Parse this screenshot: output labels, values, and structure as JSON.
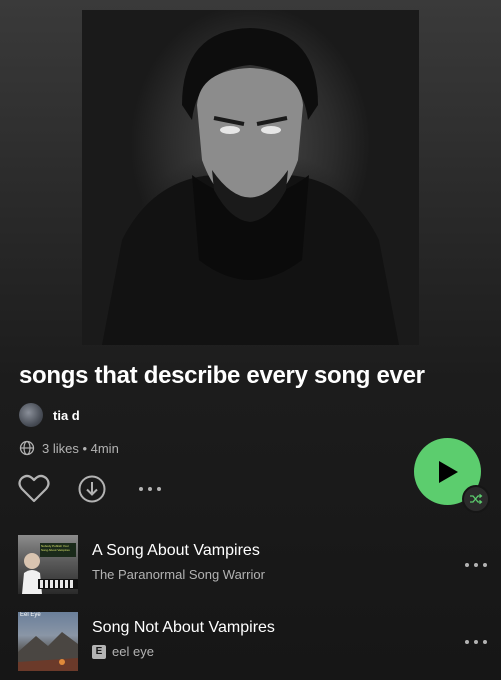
{
  "playlist": {
    "title": "songs that describe every song ever",
    "owner": "tia d",
    "meta": "3 likes • 4min"
  },
  "cover": {
    "icon": "playlist-cover-image"
  },
  "actions": {
    "like_icon": "heart-icon",
    "download_icon": "download-icon",
    "more_icon": "more-icon",
    "play_icon": "play-icon",
    "shuffle_icon": "shuffle-icon"
  },
  "colors": {
    "accent": "#5ccd6e",
    "text_primary": "#ffffff",
    "text_secondary": "#b3b3b3",
    "background": "#161616"
  },
  "tracks": [
    {
      "title": "A Song About Vampires",
      "artist": "The Paranormal Song Warrior",
      "explicit": false,
      "thumb_text": "Nobody Publish Your Song About Vampires"
    },
    {
      "title": "Song Not About Vampires",
      "artist": "eel eye",
      "explicit": true,
      "explicit_label": "E",
      "thumb_text": "Eel Eye"
    }
  ]
}
